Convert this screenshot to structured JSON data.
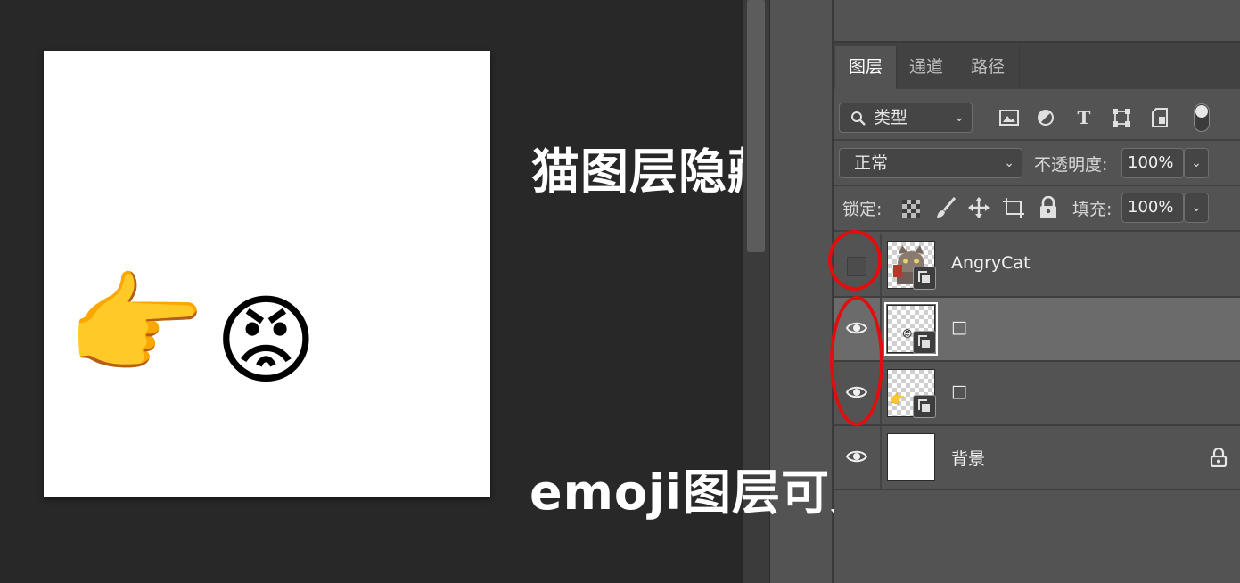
{
  "annotations": {
    "cat_hidden": "猫图层隐藏",
    "emoji_visible": "emoji图层可见"
  },
  "canvas": {
    "emojis": [
      "👉",
      "😡"
    ]
  },
  "panel": {
    "tabs": [
      {
        "label": "图层",
        "active": true
      },
      {
        "label": "通道",
        "active": false
      },
      {
        "label": "路径",
        "active": false
      }
    ],
    "filter": {
      "label": "类型",
      "icons": [
        "image-filter-icon",
        "adjustment-filter-icon",
        "type-filter-icon",
        "shape-filter-icon",
        "smart-object-filter-icon"
      ]
    },
    "blend_mode": "正常",
    "opacity_label": "不透明度:",
    "opacity_value": "100%",
    "lock_label": "锁定:",
    "fill_label": "填充:",
    "fill_value": "100%",
    "layers": [
      {
        "name": "AngryCat",
        "visible": false,
        "selected": false,
        "smart_object": true,
        "locked": false
      },
      {
        "name": "□",
        "visible": true,
        "selected": true,
        "smart_object": true,
        "locked": false
      },
      {
        "name": "□",
        "visible": true,
        "selected": false,
        "smart_object": true,
        "locked": false
      },
      {
        "name": "背景",
        "visible": true,
        "selected": false,
        "smart_object": false,
        "locked": true
      }
    ]
  },
  "colors": {
    "annotation_ring": "#e30d0d",
    "panel_bg": "#535353",
    "workspace_bg": "#282828"
  }
}
